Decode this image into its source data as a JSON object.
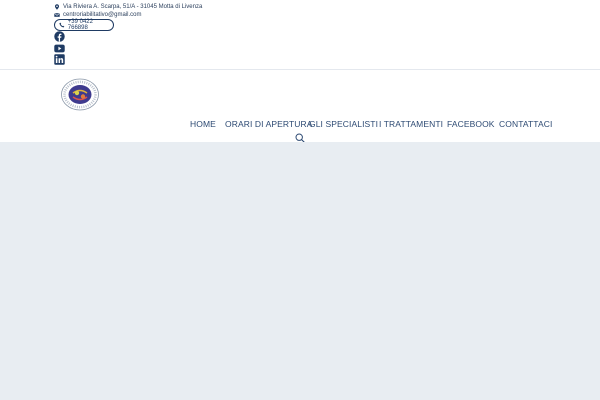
{
  "topbar": {
    "address": "Via Riviera A. Scarpa, 51/A - 31045 Motta di Livenza",
    "email": "centroriabilitativo@gmail.com",
    "phone": "+39 0422 766898"
  },
  "icons": {
    "address": "map-marker-icon",
    "email": "envelope-icon",
    "phone": "phone-icon",
    "social": [
      "facebook-icon",
      "youtube-icon",
      "linkedin-icon"
    ],
    "search": "search-icon"
  },
  "nav": {
    "items": [
      "HOME",
      "ORARI DI APERTURA",
      "GLI SPECIALISTI",
      "I TRATTAMENTI",
      "FACEBOOK",
      "CONTATTACI"
    ]
  },
  "colors": {
    "accent": "#1f3b63",
    "nav_text": "#2d4a73",
    "content_bg": "#e8edf2"
  }
}
